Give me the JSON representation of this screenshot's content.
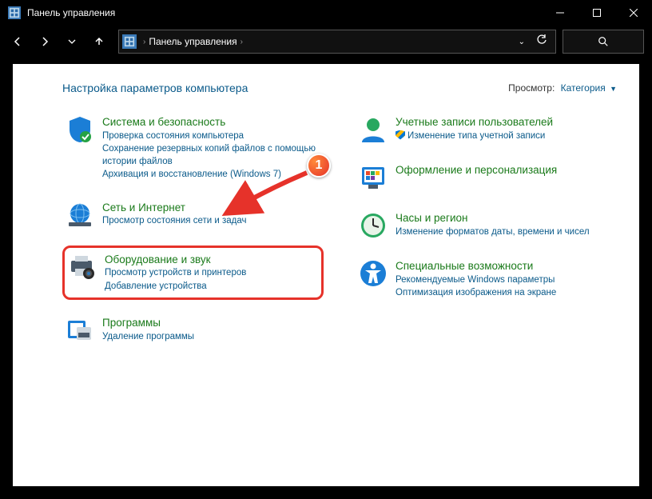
{
  "window": {
    "title": "Панель управления"
  },
  "breadcrumb": {
    "root": "Панель управления"
  },
  "header": {
    "heading": "Настройка параметров компьютера",
    "view_label": "Просмотр:",
    "view_value": "Категория"
  },
  "annotation": {
    "number": "1"
  },
  "left": [
    {
      "id": "system-security",
      "title": "Система и безопасность",
      "links": [
        "Проверка состояния компьютера",
        "Сохранение резервных копий файлов с помощью истории файлов",
        "Архивация и восстановление (Windows 7)"
      ]
    },
    {
      "id": "network",
      "title": "Сеть и Интернет",
      "links": [
        "Просмотр состояния сети и задач"
      ]
    },
    {
      "id": "hardware-sound",
      "title": "Оборудование и звук",
      "links": [
        "Просмотр устройств и принтеров",
        "Добавление устройства"
      ],
      "highlight": true
    },
    {
      "id": "programs",
      "title": "Программы",
      "links": [
        "Удаление программы"
      ]
    }
  ],
  "right": [
    {
      "id": "user-accounts",
      "title": "Учетные записи пользователей",
      "links": [
        "Изменение типа учетной записи"
      ],
      "shield": [
        true
      ]
    },
    {
      "id": "appearance",
      "title": "Оформление и персонализация",
      "links": []
    },
    {
      "id": "clock-region",
      "title": "Часы и регион",
      "links": [
        "Изменение форматов даты, времени и чисел"
      ]
    },
    {
      "id": "ease-of-access",
      "title": "Специальные возможности",
      "links": [
        "Рекомендуемые Windows параметры",
        "Оптимизация изображения на экране"
      ]
    }
  ]
}
